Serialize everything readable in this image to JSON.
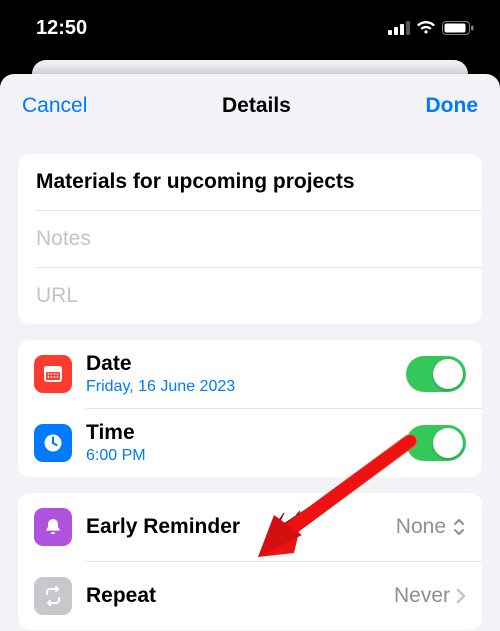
{
  "status": {
    "time": "12:50"
  },
  "nav": {
    "cancel": "Cancel",
    "title": "Details",
    "done": "Done"
  },
  "reminder": {
    "title": "Materials for upcoming projects",
    "notes_placeholder": "Notes",
    "url_placeholder": "URL"
  },
  "date_row": {
    "label": "Date",
    "value": "Friday, 16 June 2023",
    "enabled": true
  },
  "time_row": {
    "label": "Time",
    "value": "6:00 PM",
    "enabled": true
  },
  "early_reminder": {
    "label": "Early Reminder",
    "value": "None"
  },
  "repeat": {
    "label": "Repeat",
    "value": "Never"
  }
}
